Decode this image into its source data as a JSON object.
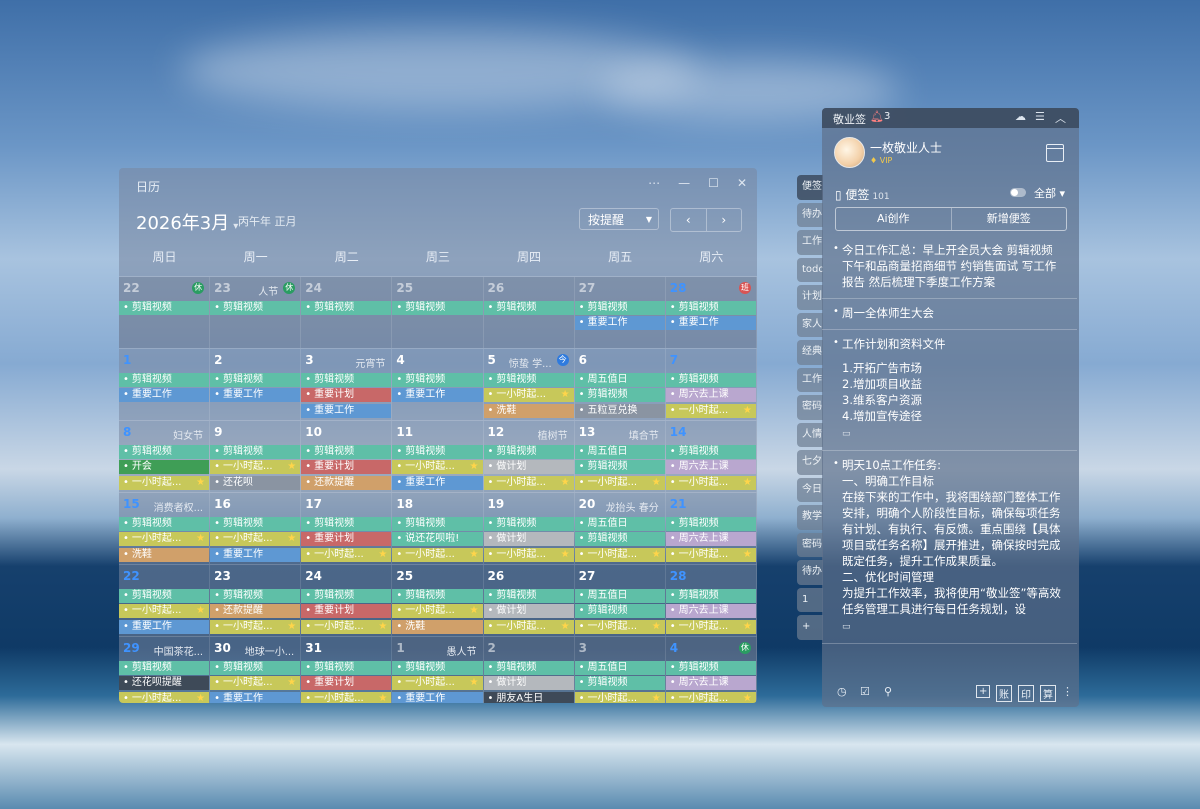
{
  "calendar": {
    "title": "日历",
    "month": "2026年3月",
    "lunar": "丙午年 正月",
    "remind_select": "按提醒",
    "weekdays": [
      "周日",
      "周一",
      "周二",
      "周三",
      "周四",
      "周五",
      "周六"
    ],
    "weeks": [
      [
        {
          "d": "22",
          "other": true,
          "badge": "休",
          "badgeType": "rest",
          "ev": [
            [
              "剪辑视频",
              "teal"
            ]
          ]
        },
        {
          "d": "23",
          "other": true,
          "fest": "人节",
          "badge": "休",
          "badgeType": "rest",
          "ev": [
            [
              "剪辑视频",
              "teal"
            ]
          ]
        },
        {
          "d": "24",
          "other": true,
          "ev": [
            [
              "剪辑视频",
              "teal"
            ]
          ]
        },
        {
          "d": "25",
          "other": true,
          "ev": [
            [
              "剪辑视频",
              "teal"
            ]
          ]
        },
        {
          "d": "26",
          "other": true,
          "ev": [
            [
              "剪辑视频",
              "teal"
            ]
          ]
        },
        {
          "d": "27",
          "other": true,
          "ev": [
            [
              "剪辑视频",
              "teal"
            ],
            [
              "重要工作",
              "blue"
            ]
          ]
        },
        {
          "d": "28",
          "other": true,
          "blue": true,
          "badge": "班",
          "badgeType": "work",
          "ev": [
            [
              "剪辑视频",
              "teal"
            ],
            [
              "重要工作",
              "blue"
            ]
          ]
        }
      ],
      [
        {
          "d": "1",
          "blue": true,
          "ev": [
            [
              "剪辑视频",
              "teal"
            ],
            [
              "重要工作",
              "blue"
            ]
          ]
        },
        {
          "d": "2",
          "ev": [
            [
              "剪辑视频",
              "teal"
            ],
            [
              "重要工作",
              "blue"
            ]
          ]
        },
        {
          "d": "3",
          "fest": "元宵节",
          "ev": [
            [
              "剪辑视频",
              "teal"
            ],
            [
              "重要计划",
              "red"
            ],
            [
              "重要工作",
              "blue"
            ]
          ]
        },
        {
          "d": "4",
          "ev": [
            [
              "剪辑视频",
              "teal"
            ],
            [
              "重要工作",
              "blue"
            ]
          ]
        },
        {
          "d": "5",
          "fest": "惊蛰 学...",
          "badge": "今",
          "badgeType": "today",
          "ev": [
            [
              "剪辑视频",
              "teal"
            ],
            [
              "一小时起...",
              "yel",
              true
            ],
            [
              "洗鞋",
              "orange"
            ]
          ]
        },
        {
          "d": "6",
          "ev": [
            [
              "周五值日",
              "teal"
            ],
            [
              "剪辑视频",
              "teal"
            ],
            [
              "五粒豆兑换",
              "gray"
            ]
          ]
        },
        {
          "d": "7",
          "blue": true,
          "ev": [
            [
              "剪辑视频",
              "teal"
            ],
            [
              "周六去上课",
              "purple"
            ],
            [
              "一小时起...",
              "yel",
              true
            ]
          ]
        }
      ],
      [
        {
          "d": "8",
          "blue": true,
          "fest": "妇女节",
          "ev": [
            [
              "剪辑视频",
              "teal"
            ],
            [
              "开会",
              "green"
            ],
            [
              "一小时起...",
              "yel",
              true
            ]
          ]
        },
        {
          "d": "9",
          "ev": [
            [
              "剪辑视频",
              "teal"
            ],
            [
              "一小时起...",
              "yel",
              true
            ],
            [
              "还花呗",
              "gray"
            ]
          ]
        },
        {
          "d": "10",
          "ev": [
            [
              "剪辑视频",
              "teal"
            ],
            [
              "重要计划",
              "red"
            ],
            [
              "还款提醒",
              "orange"
            ]
          ]
        },
        {
          "d": "11",
          "ev": [
            [
              "剪辑视频",
              "teal"
            ],
            [
              "一小时起...",
              "yel",
              true
            ],
            [
              "重要工作",
              "blue"
            ]
          ]
        },
        {
          "d": "12",
          "fest": "植树节",
          "ev": [
            [
              "剪辑视频",
              "teal"
            ],
            [
              "做计划",
              "lgray"
            ],
            [
              "一小时起...",
              "yel",
              true
            ]
          ]
        },
        {
          "d": "13",
          "fest": "填合节",
          "ev": [
            [
              "周五值日",
              "teal"
            ],
            [
              "剪辑视频",
              "teal"
            ],
            [
              "一小时起...",
              "yel",
              true
            ]
          ]
        },
        {
          "d": "14",
          "blue": true,
          "ev": [
            [
              "剪辑视频",
              "teal"
            ],
            [
              "周六去上课",
              "purple"
            ],
            [
              "一小时起...",
              "yel",
              true
            ]
          ]
        }
      ],
      [
        {
          "d": "15",
          "blue": true,
          "fest": "消费者权...",
          "ev": [
            [
              "剪辑视频",
              "teal"
            ],
            [
              "一小时起...",
              "yel",
              true
            ],
            [
              "洗鞋",
              "orange"
            ]
          ]
        },
        {
          "d": "16",
          "ev": [
            [
              "剪辑视频",
              "teal"
            ],
            [
              "一小时起...",
              "yel",
              true
            ],
            [
              "重要工作",
              "blue"
            ]
          ]
        },
        {
          "d": "17",
          "ev": [
            [
              "剪辑视频",
              "teal"
            ],
            [
              "重要计划",
              "red"
            ],
            [
              "一小时起...",
              "yel",
              true
            ]
          ]
        },
        {
          "d": "18",
          "ev": [
            [
              "剪辑视频",
              "teal"
            ],
            [
              "说还花呗啦!",
              "teal"
            ],
            [
              "一小时起...",
              "yel",
              true
            ]
          ]
        },
        {
          "d": "19",
          "ev": [
            [
              "剪辑视频",
              "teal"
            ],
            [
              "做计划",
              "lgray"
            ],
            [
              "一小时起...",
              "yel",
              true
            ]
          ]
        },
        {
          "d": "20",
          "fest": "龙抬头 春分",
          "ev": [
            [
              "周五值日",
              "teal"
            ],
            [
              "剪辑视频",
              "teal"
            ],
            [
              "一小时起...",
              "yel",
              true
            ]
          ]
        },
        {
          "d": "21",
          "blue": true,
          "ev": [
            [
              "剪辑视频",
              "teal"
            ],
            [
              "周六去上课",
              "purple"
            ],
            [
              "一小时起...",
              "yel",
              true
            ]
          ]
        }
      ],
      [
        {
          "d": "22",
          "blue": true,
          "ev": [
            [
              "剪辑视频",
              "teal"
            ],
            [
              "一小时起...",
              "yel",
              true
            ],
            [
              "重要工作",
              "blue"
            ]
          ]
        },
        {
          "d": "23",
          "ev": [
            [
              "剪辑视频",
              "teal"
            ],
            [
              "还款提醒",
              "orange"
            ],
            [
              "一小时起...",
              "yel",
              true
            ]
          ]
        },
        {
          "d": "24",
          "ev": [
            [
              "剪辑视频",
              "teal"
            ],
            [
              "重要计划",
              "red"
            ],
            [
              "一小时起...",
              "yel",
              true
            ]
          ]
        },
        {
          "d": "25",
          "ev": [
            [
              "剪辑视频",
              "teal"
            ],
            [
              "一小时起...",
              "yel",
              true
            ],
            [
              "洗鞋",
              "orange"
            ]
          ]
        },
        {
          "d": "26",
          "ev": [
            [
              "剪辑视频",
              "teal"
            ],
            [
              "做计划",
              "lgray"
            ],
            [
              "一小时起...",
              "yel",
              true
            ]
          ]
        },
        {
          "d": "27",
          "ev": [
            [
              "周五值日",
              "teal"
            ],
            [
              "剪辑视频",
              "teal"
            ],
            [
              "一小时起...",
              "yel",
              true
            ]
          ]
        },
        {
          "d": "28",
          "blue": true,
          "ev": [
            [
              "剪辑视频",
              "teal"
            ],
            [
              "周六去上课",
              "purple"
            ],
            [
              "一小时起...",
              "yel",
              true
            ]
          ]
        }
      ],
      [
        {
          "d": "29",
          "blue": true,
          "fest": "中国茶花...",
          "ev": [
            [
              "剪辑视频",
              "teal"
            ],
            [
              "还花呗提醒",
              "dark"
            ],
            [
              "一小时起...",
              "yel",
              true
            ]
          ]
        },
        {
          "d": "30",
          "fest": "地球一小...",
          "ev": [
            [
              "剪辑视频",
              "teal"
            ],
            [
              "一小时起...",
              "yel",
              true
            ],
            [
              "重要工作",
              "blue"
            ]
          ]
        },
        {
          "d": "31",
          "ev": [
            [
              "剪辑视频",
              "teal"
            ],
            [
              "重要计划",
              "red"
            ],
            [
              "一小时起...",
              "yel",
              true
            ]
          ]
        },
        {
          "d": "1",
          "other": true,
          "fest": "愚人节",
          "ev": [
            [
              "剪辑视频",
              "teal"
            ],
            [
              "一小时起...",
              "yel",
              true
            ],
            [
              "重要工作",
              "blue"
            ]
          ]
        },
        {
          "d": "2",
          "other": true,
          "ev": [
            [
              "剪辑视频",
              "teal"
            ],
            [
              "做计划",
              "lgray"
            ],
            [
              "朋友A生日",
              "dark"
            ]
          ]
        },
        {
          "d": "3",
          "other": true,
          "ev": [
            [
              "周五值日",
              "teal"
            ],
            [
              "剪辑视频",
              "teal"
            ],
            [
              "一小时起...",
              "yel",
              true
            ]
          ]
        },
        {
          "d": "4",
          "other": true,
          "blue": true,
          "badge": "休",
          "badgeType": "rest",
          "ev": [
            [
              "剪辑视频",
              "teal"
            ],
            [
              "周六去上课",
              "purple"
            ],
            [
              "一小时起...",
              "yel",
              true
            ]
          ]
        }
      ]
    ]
  },
  "side_tabs": [
    "便签",
    "待办",
    "工作",
    "todo",
    "计划",
    "家人",
    "经典",
    "工作",
    "密码",
    "人情",
    "七夕",
    "今日",
    "教学",
    "密码",
    "待办",
    "1",
    "+"
  ],
  "note": {
    "app_title": "敬业签",
    "alert_count": "3",
    "username": "一枚敬业人士",
    "vip_label": "VIP",
    "section_title": "便签",
    "section_count": "101",
    "filter": "全部",
    "ai_button": "Ai创作",
    "new_button": "新增便签",
    "items": [
      {
        "lines": [
          "今日工作汇总：早上开全员大会 剪辑视频 下午和品商量招商细节 约销售面试 写工作报告 然后梳理下季度工作方案"
        ]
      },
      {
        "lines": [
          "周一全体师生大会"
        ]
      },
      {
        "lines": [
          "工作计划和资料文件",
          "",
          "1.开拓广告市场",
          "2.增加项目收益",
          "3.维系客户资源",
          "4.增加宣传途径"
        ],
        "icon": true
      },
      {
        "lines": [
          "明天10点工作任务:",
          "一、明确工作目标",
          "在接下来的工作中，我将围绕部门整体工作安排，明确个人阶段性目标，确保每项任务有计划、有执行、有反馈。重点围绕【具体项目或任务名称】展开推进，确保按时完成既定任务，提升工作成果质量。",
          "二、优化时间管理",
          "为提升工作效率，我将使用“敬业签”等高效任务管理工具进行每日任务规划，设"
        ],
        "icon": true
      }
    ],
    "footer_right": [
      "账",
      "印",
      "算"
    ]
  }
}
